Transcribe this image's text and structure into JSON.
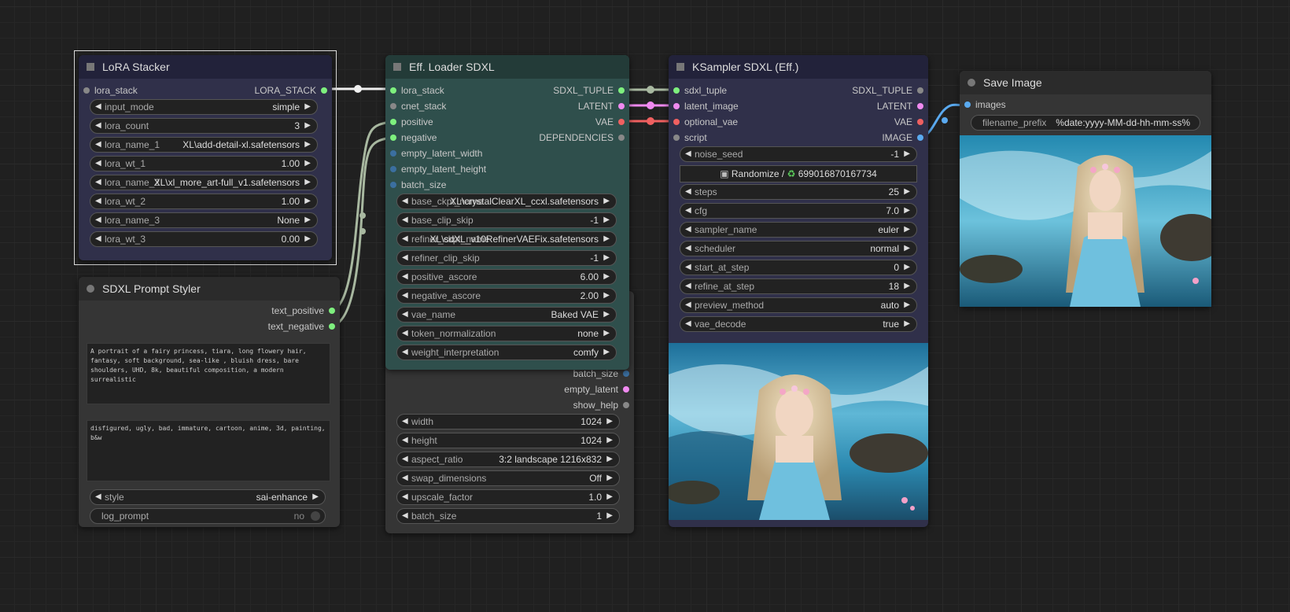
{
  "colors": {
    "canvas_bg": "#202020",
    "lora_node_bg": "#30304a",
    "lora_title_bg": "#22223a",
    "loader_node_bg": "#2f4f4c",
    "loader_title_bg": "#233b38",
    "ksampler_bg": "#30304a",
    "ksampler_title_bg": "#22223a",
    "generic_node_bg": "#353535",
    "generic_title_bg": "#2b2b2b",
    "pin_green": "#7ef07e",
    "pin_pink": "#f08af0",
    "pin_red": "#f06060",
    "pin_blue": "#5aaaf0",
    "pin_gray": "#888888",
    "wire_gray": "#a8b8a0",
    "wire_pink": "#f08af0",
    "wire_red": "#f06060",
    "wire_blue": "#5aaaf0"
  },
  "lora": {
    "title": "LoRA Stacker",
    "input": "lora_stack",
    "output": "LORA_STACK",
    "widgets": [
      {
        "label": "input_mode",
        "value": "simple"
      },
      {
        "label": "lora_count",
        "value": "3"
      },
      {
        "label": "lora_name_1",
        "value": "XL\\add-detail-xl.safetensors"
      },
      {
        "label": "lora_wt_1",
        "value": "1.00"
      },
      {
        "label": "lora_name_2",
        "value": "XL\\xl_more_art-full_v1.safetensors"
      },
      {
        "label": "lora_wt_2",
        "value": "1.00"
      },
      {
        "label": "lora_name_3",
        "value": "None"
      },
      {
        "label": "lora_wt_3",
        "value": "0.00"
      }
    ]
  },
  "styler": {
    "title": "SDXL Prompt Styler",
    "outputs": [
      "text_positive",
      "text_negative"
    ],
    "positive_text": "A portrait of a fairy princess, tiara, long flowery hair, fantasy, soft background, sea-like , bluish dress, bare shoulders, UHD, 8k, beautiful composition, a modern surrealistic",
    "negative_text": "disfigured, ugly, bad, immature, cartoon, anime, 3d, painting, b&w",
    "style_label": "style",
    "style_value": "sai-enhance",
    "log_label": "log_prompt",
    "log_value": "no"
  },
  "loader": {
    "title": "Eff. Loader SDXL",
    "inputs": [
      "lora_stack",
      "cnet_stack",
      "positive",
      "negative",
      "empty_latent_width",
      "empty_latent_height",
      "batch_size"
    ],
    "outputs": [
      "SDXL_TUPLE",
      "LATENT",
      "VAE",
      "DEPENDENCIES"
    ],
    "widgets": [
      {
        "label": "base_ckpt_name",
        "value": "XL\\crystalClearXL_ccxl.safetensors"
      },
      {
        "label": "base_clip_skip",
        "value": "-1"
      },
      {
        "label": "refiner_ckpt_name",
        "value": "XL\\sdXL_v10RefinerVAEFix.safetensors"
      },
      {
        "label": "refiner_clip_skip",
        "value": "-1"
      },
      {
        "label": "positive_ascore",
        "value": "6.00"
      },
      {
        "label": "negative_ascore",
        "value": "2.00"
      },
      {
        "label": "vae_name",
        "value": "Baked VAE"
      },
      {
        "label": "token_normalization",
        "value": "none"
      },
      {
        "label": "weight_interpretation",
        "value": "comfy"
      }
    ]
  },
  "latent": {
    "outputs": [
      "batch_size",
      "empty_latent",
      "show_help"
    ],
    "widgets": [
      {
        "label": "width",
        "value": "1024"
      },
      {
        "label": "height",
        "value": "1024"
      },
      {
        "label": "aspect_ratio",
        "value": "3:2 landscape 1216x832"
      },
      {
        "label": "swap_dimensions",
        "value": "Off"
      },
      {
        "label": "upscale_factor",
        "value": "1.0"
      },
      {
        "label": "batch_size",
        "value": "1"
      }
    ]
  },
  "ksampler": {
    "title": "KSampler SDXL (Eff.)",
    "inputs": [
      "sdxl_tuple",
      "latent_image",
      "optional_vae",
      "script"
    ],
    "outputs": [
      "SDXL_TUPLE",
      "LATENT",
      "VAE",
      "IMAGE"
    ],
    "seed_label": "noise_seed",
    "seed_value": "-1",
    "randomize_text": "Randomize /",
    "randomize_seed": "699016870167734",
    "widgets": [
      {
        "label": "steps",
        "value": "25"
      },
      {
        "label": "cfg",
        "value": "7.0"
      },
      {
        "label": "sampler_name",
        "value": "euler"
      },
      {
        "label": "scheduler",
        "value": "normal"
      },
      {
        "label": "start_at_step",
        "value": "0"
      },
      {
        "label": "refine_at_step",
        "value": "18"
      },
      {
        "label": "preview_method",
        "value": "auto"
      },
      {
        "label": "vae_decode",
        "value": "true"
      }
    ]
  },
  "save": {
    "title": "Save Image",
    "input": "images",
    "prefix_label": "filename_prefix",
    "prefix_value": "%date:yyyy-MM-dd-hh-mm-ss%"
  }
}
